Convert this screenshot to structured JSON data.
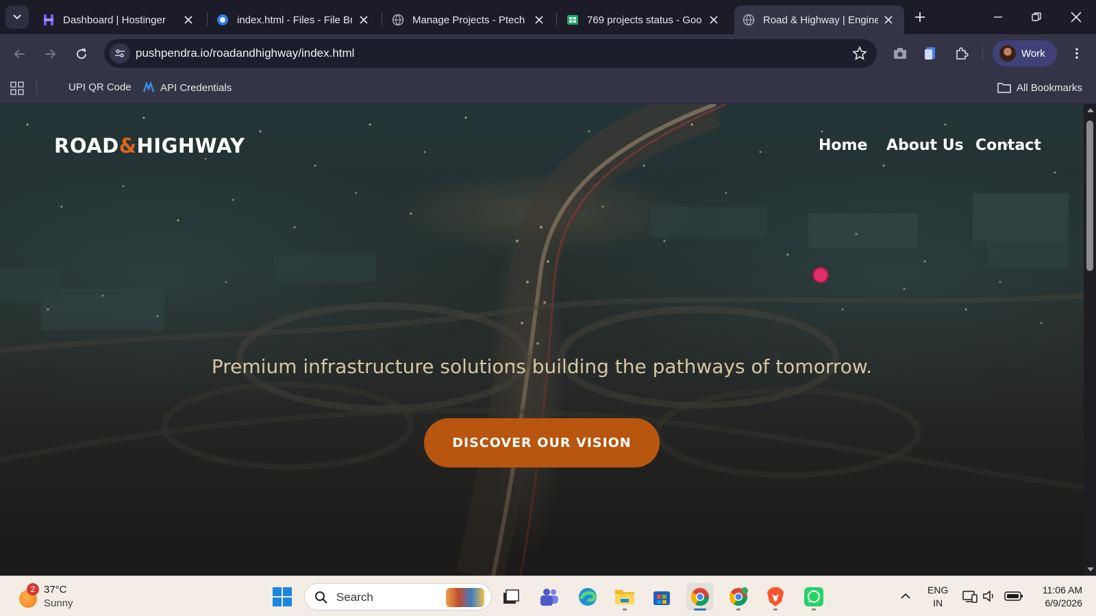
{
  "browser": {
    "tabs": [
      {
        "title": "Dashboard | Hostinger",
        "favicon": "hostinger-icon",
        "active": false
      },
      {
        "title": "index.html - Files - File Br",
        "favicon": "file-browser-icon",
        "active": false
      },
      {
        "title": "Manage Projects - Ptech",
        "favicon": "globe-icon",
        "active": false
      },
      {
        "title": "769 projects status - Goo",
        "favicon": "google-sheets-icon",
        "active": false
      },
      {
        "title": "Road & Highway | Engine",
        "favicon": "globe-icon",
        "active": true
      }
    ],
    "url": "pushpendra.io/roadandhighway/index.html",
    "profile_label": "Work",
    "bookmarks": [
      {
        "label": "UPI QR Code"
      },
      {
        "label": "API Credentials"
      }
    ],
    "all_bookmarks_label": "All Bookmarks"
  },
  "page": {
    "logo_part1": "ROAD",
    "logo_amp": "&",
    "logo_part2": "HIGHWAY",
    "nav": [
      "Home",
      "About Us",
      "Contact"
    ],
    "tagline": "Premium infrastructure solutions building the pathways of tomorrow.",
    "cta_label": "DISCOVER OUR VISION"
  },
  "taskbar": {
    "weather_badge": "2",
    "weather_temp": "37°C",
    "weather_cond": "Sunny",
    "search_placeholder": "Search",
    "lang_line1": "ENG",
    "lang_line2": "IN",
    "time": "11:06 AM",
    "date": "6/9/2026"
  },
  "colors": {
    "accent": "#b8560f",
    "logo_amp": "#d9661d",
    "tagline": "#d6c7a4",
    "chrome_dark": "#1b1c28",
    "chrome_toolbar": "#333547"
  }
}
